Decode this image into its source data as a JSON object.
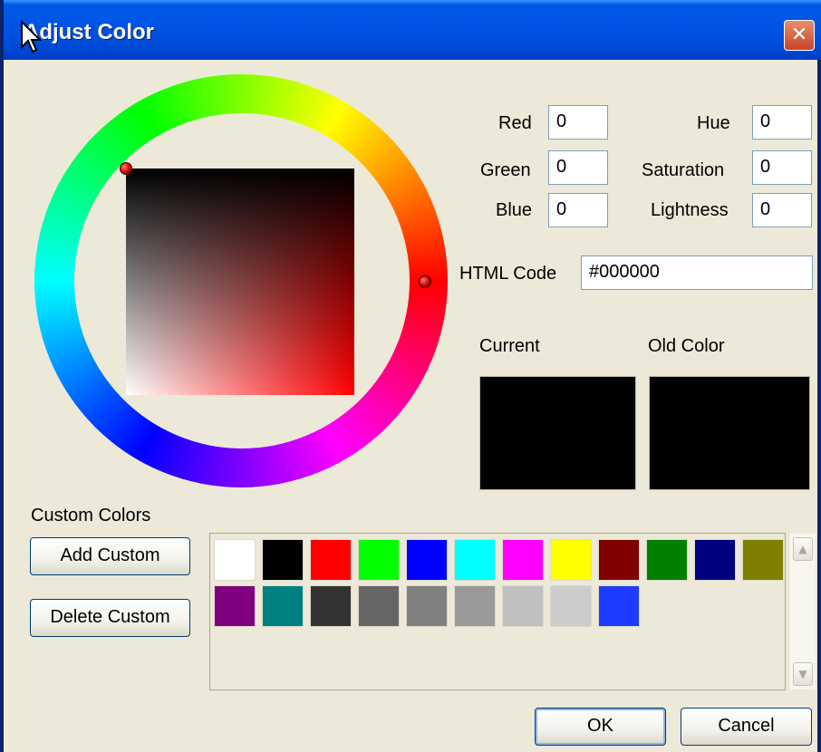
{
  "window": {
    "title": "Adjust Color",
    "close_glyph": "✕"
  },
  "rgb": {
    "red_label": "Red",
    "red_value": "0",
    "green_label": "Green",
    "green_value": "0",
    "blue_label": "Blue",
    "blue_value": "0"
  },
  "hsl": {
    "hue_label": "Hue",
    "hue_value": "0",
    "saturation_label": "Saturation",
    "saturation_value": "0",
    "lightness_label": "Lightness",
    "lightness_value": "0"
  },
  "html_code": {
    "label": "HTML Code",
    "value": "#000000"
  },
  "preview": {
    "current_label": "Current",
    "old_label": "Old Color",
    "current_color": "#000000",
    "old_color": "#000000"
  },
  "custom": {
    "label": "Custom Colors",
    "add_label": "Add Custom",
    "delete_label": "Delete Custom",
    "swatches": [
      "#ffffff",
      "#000000",
      "#ff0000",
      "#00ff00",
      "#0000ff",
      "#00ffff",
      "#ff00ff",
      "#ffff00",
      "#800000",
      "#008000",
      "#000080",
      "#808000",
      "#800080",
      "#008080",
      "#333333",
      "#666666",
      "#808080",
      "#999999",
      "#c0c0c0",
      "#cccccc",
      "#1e3cff"
    ]
  },
  "buttons": {
    "ok": "OK",
    "cancel": "Cancel"
  },
  "scrollbar": {
    "up_glyph": "▲",
    "down_glyph": "▼"
  }
}
